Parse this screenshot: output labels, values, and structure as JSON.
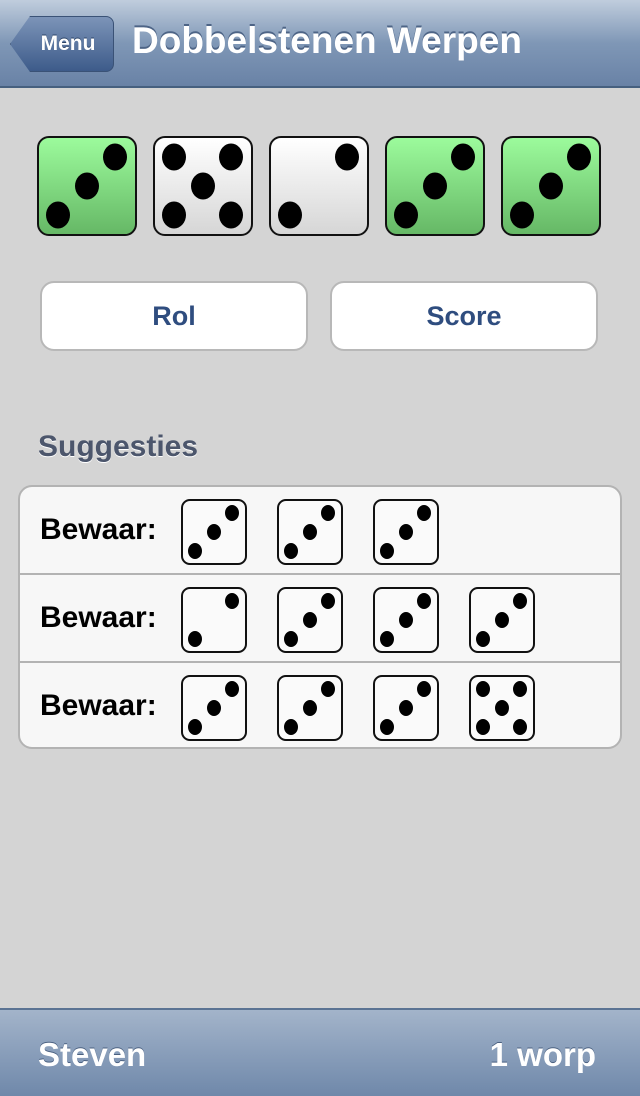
{
  "nav": {
    "back_label": "Menu",
    "title": "Dobbelstenen Werpen"
  },
  "dice": [
    {
      "value": 3,
      "held": true
    },
    {
      "value": 5,
      "held": false
    },
    {
      "value": 2,
      "held": false
    },
    {
      "value": 3,
      "held": true
    },
    {
      "value": 3,
      "held": true
    }
  ],
  "buttons": {
    "roll": "Rol",
    "score": "Score"
  },
  "suggestions": {
    "title": "Suggesties",
    "rows": [
      {
        "label": "Bewaar:",
        "dice": [
          3,
          3,
          3
        ]
      },
      {
        "label": "Bewaar:",
        "dice": [
          2,
          3,
          3,
          3
        ]
      },
      {
        "label": "Bewaar:",
        "dice": [
          3,
          3,
          3,
          5
        ]
      }
    ]
  },
  "footer": {
    "player": "Steven",
    "throws": "1 worp"
  },
  "colors": {
    "held": "#8fe98f",
    "accent": "#2f4d7f"
  }
}
